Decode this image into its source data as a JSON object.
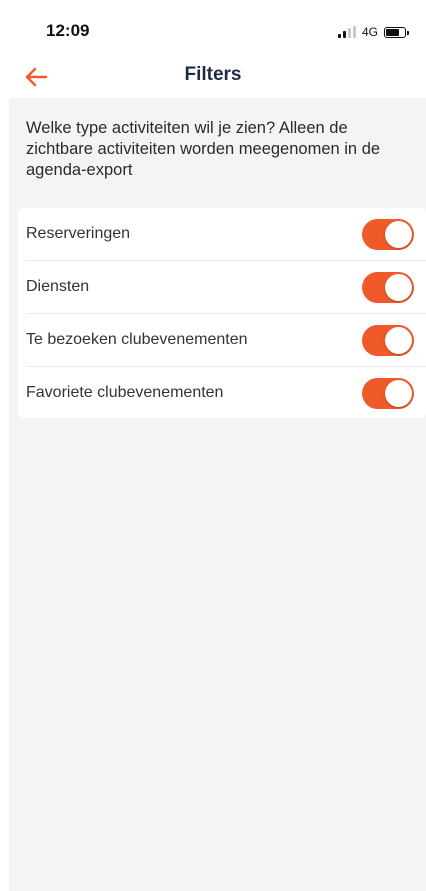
{
  "status_bar": {
    "time": "12:09",
    "network": "4G",
    "battery_icon": "battery-icon",
    "signal_icon": "signal-icon"
  },
  "nav": {
    "title": "Filters",
    "back_icon": "arrow-left-icon"
  },
  "intro_text": "Welke type activiteiten wil je zien? Alleen de zichtbare activiteiten worden meegenomen in de agenda-export",
  "filters": [
    {
      "label": "Reserveringen",
      "enabled": true
    },
    {
      "label": "Diensten",
      "enabled": true
    },
    {
      "label": "Te bezoeken clubevenementen",
      "enabled": true
    },
    {
      "label": "Favoriete clubevenementen",
      "enabled": true
    }
  ],
  "colors": {
    "accent": "#f05a2a",
    "title": "#1f2a44",
    "background": "#f4f4f7"
  }
}
